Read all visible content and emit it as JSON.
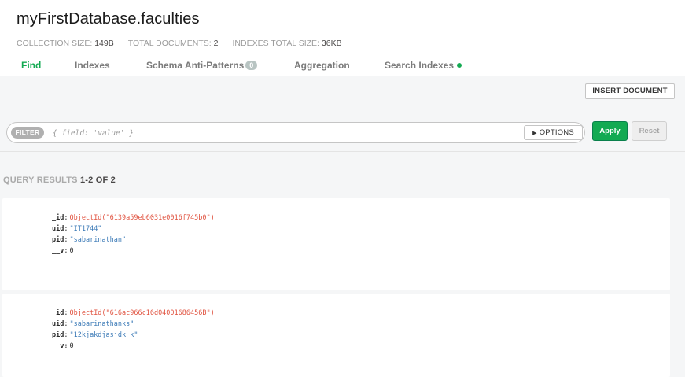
{
  "header": {
    "title": "myFirstDatabase.faculties",
    "stats": [
      {
        "label": "COLLECTION SIZE:",
        "value": "149B"
      },
      {
        "label": "TOTAL DOCUMENTS:",
        "value": "2"
      },
      {
        "label": "INDEXES TOTAL SIZE:",
        "value": "36KB"
      }
    ]
  },
  "tabs": [
    {
      "label": "Find",
      "active": true
    },
    {
      "label": "Indexes"
    },
    {
      "label": "Schema Anti-Patterns",
      "badge": "0"
    },
    {
      "label": "Aggregation"
    },
    {
      "label": "Search Indexes",
      "status": "green-dot"
    }
  ],
  "toolbar": {
    "insert_label": "INSERT DOCUMENT",
    "filter_label": "FILTER",
    "filter_placeholder": "{ field: 'value' }",
    "options_label": "OPTIONS",
    "apply_label": "Apply",
    "reset_label": "Reset"
  },
  "results": {
    "prefix": "QUERY RESULTS",
    "range": "1-2 OF 2"
  },
  "documents": [
    {
      "_id": "ObjectId(\"6139a59eb6031e0016f745b0\")",
      "uid": "\"IT1744\"",
      "pid": "\"sabarinathan\"",
      "__v": "0"
    },
    {
      "_id": "ObjectId(\"616ac966c16d04001686456B\")",
      "uid": "\"sabarinathanks\"",
      "pid": "\"12kjakdjasjdk k\"",
      "__v": "0"
    }
  ],
  "field_keys": {
    "id": "_id",
    "uid": "uid",
    "pid": "pid",
    "v": "__v"
  },
  "colors": {
    "accent": "#13aa52",
    "objectid": "#e0523f",
    "string": "#3a79b6"
  }
}
